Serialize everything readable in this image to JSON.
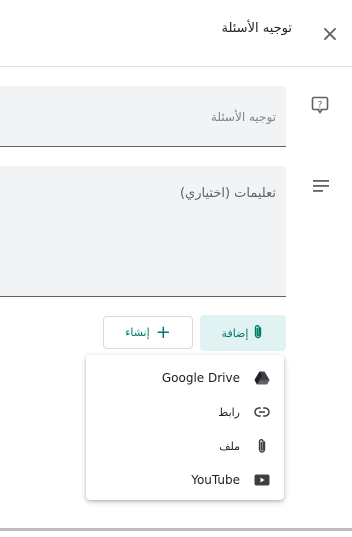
{
  "header": {
    "close_label": "×",
    "title": "توجيه الأسئلة"
  },
  "form": {
    "topic_placeholder": "توجيه الأسئلة",
    "instructions_placeholder": "تعليمات (اختياري)"
  },
  "actions": {
    "add_label": "إضافة",
    "create_label": "إنشاء"
  },
  "add_menu": {
    "items": [
      {
        "label": "Google Drive",
        "icon": "google-drive-icon"
      },
      {
        "label": "رابط",
        "icon": "link-icon"
      },
      {
        "label": "ملف",
        "icon": "attach-file-icon"
      },
      {
        "label": "YouTube",
        "icon": "youtube-icon"
      }
    ]
  },
  "colors": {
    "accent": "#00796b",
    "accent_bg": "#e0f2f1",
    "field_bg": "#f1f3f4"
  }
}
